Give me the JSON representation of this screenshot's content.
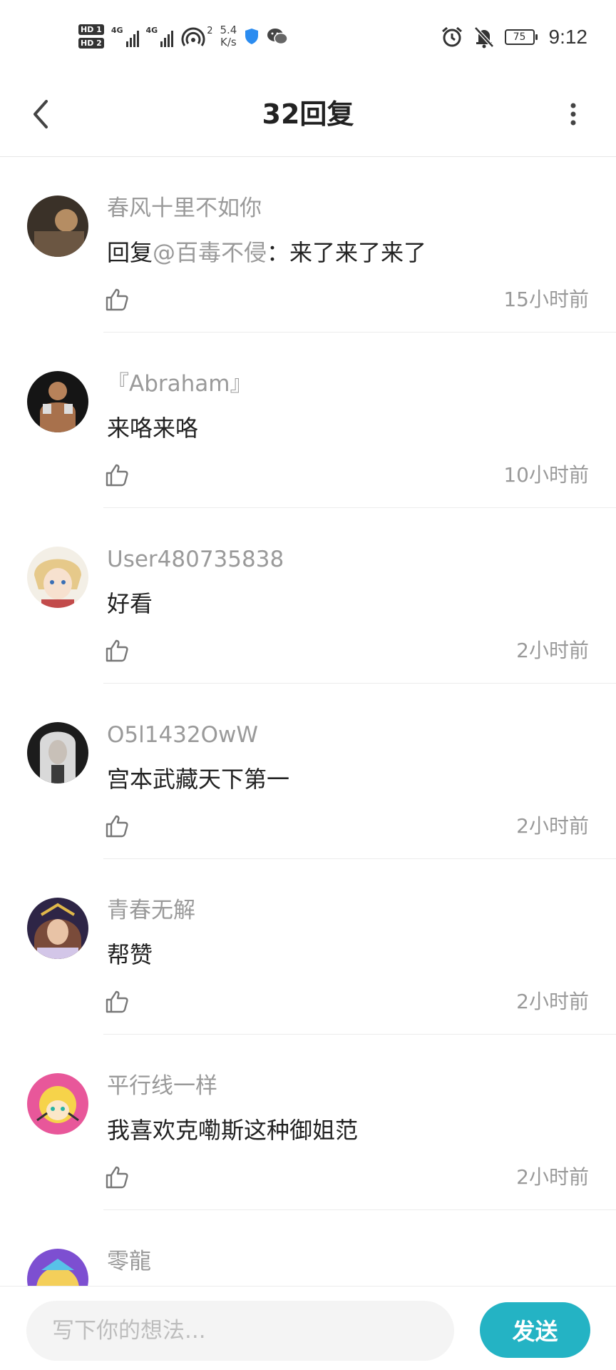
{
  "status_bar": {
    "sim1": "HD 1",
    "sim2": "HD 2",
    "net1": "4G",
    "net2": "4G",
    "hotspot_count": "2",
    "net_speed_value": "5.4",
    "net_speed_unit": "K/s",
    "battery": "75",
    "time": "9:12",
    "icons": [
      "hotspot-icon",
      "shield-icon",
      "wechat-icon",
      "alarm-icon",
      "mute-bell-icon",
      "battery-icon"
    ]
  },
  "nav": {
    "title": "32回复",
    "back_icon": "chevron-left-icon",
    "more_icon": "more-vertical-icon"
  },
  "replies": [
    {
      "name": "春风十里不如你",
      "text_prefix": "回复",
      "mention": "@百毒不侵",
      "text": "：来了来了来了",
      "time": "15小时前"
    },
    {
      "name": "『Abraham』",
      "text_prefix": "",
      "mention": "",
      "text": "来咯来咯",
      "time": "10小时前"
    },
    {
      "name": "User480735838",
      "text_prefix": "",
      "mention": "",
      "text": "好看",
      "time": "2小时前"
    },
    {
      "name": "O5l1432OwW",
      "text_prefix": "",
      "mention": "",
      "text": "宫本武藏天下第一",
      "time": "2小时前"
    },
    {
      "name": "青春无解",
      "text_prefix": "",
      "mention": "",
      "text": "帮赞",
      "time": "2小时前"
    },
    {
      "name": "平行线一样",
      "text_prefix": "",
      "mention": "",
      "text": "我喜欢克嘞斯这种御姐范",
      "time": "2小时前"
    },
    {
      "name": "零龍",
      "text_prefix": "",
      "mention": "",
      "text": "",
      "time": ""
    }
  ],
  "input": {
    "placeholder": "写下你的想法...",
    "send_label": "发送"
  },
  "colors": {
    "accent": "#24b3c4",
    "meta_text": "#9a9a9a",
    "body_text": "#222222",
    "divider": "#ececec"
  }
}
